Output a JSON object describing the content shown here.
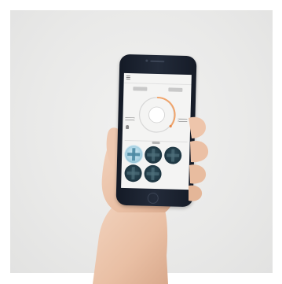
{
  "scene": {
    "background_color": "#ebebea",
    "phone_color": "#1c2230",
    "skin_color": "#edc6ae",
    "accent_color": "#f1a46a"
  },
  "app": {
    "icons": {
      "menu": "menu-icon",
      "bulb": "lightbulb-icon"
    },
    "tiles": [
      {
        "state": "active"
      },
      {
        "state": "inactive"
      },
      {
        "state": "inactive"
      },
      {
        "state": "inactive"
      },
      {
        "state": "inactive"
      }
    ]
  }
}
